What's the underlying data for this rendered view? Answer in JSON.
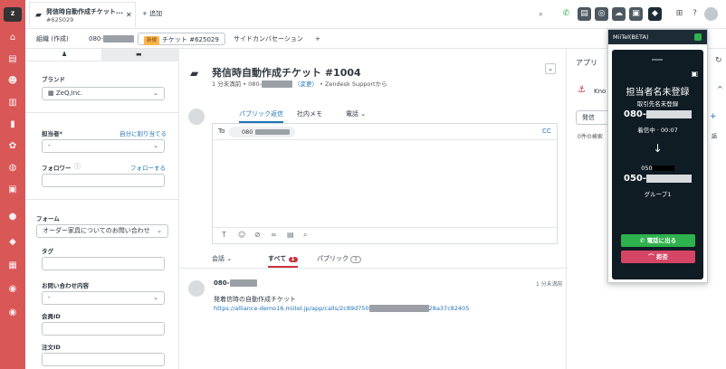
{
  "topbar": {
    "tab_title": "発信時自動作成チケット...",
    "tab_subtitle": "#625029",
    "add_tab": "+ 追加"
  },
  "crumbs": {
    "org": "組織 (作成)",
    "phone_prefix": "080-",
    "new_badge": "新規",
    "ticket": "チケット #625029",
    "side_conv": "サイドカンバセーション",
    "plus": "+"
  },
  "props": {
    "brand_label": "ブランド",
    "brand_value": "ZeQ,Inc.",
    "assignee_label": "担当者*",
    "assign_me": "自分に割り当てる",
    "assignee_value": "-",
    "follower_label": "フォロワー",
    "follow_link": "フォローする",
    "form_label": "フォーム",
    "form_value": "オーダー家具についてのお問い合わせ",
    "tags_label": "タグ",
    "inquiry_label": "お問い合わせ内容",
    "inquiry_value": "-",
    "member_label": "会員ID",
    "order_label": "注文ID"
  },
  "ticket": {
    "title": "発信時自動作成チケット #1004",
    "sub_time": "1 分未満前 • 080-",
    "sub_change": "（変更）",
    "sub_source": "• Zendesk Supportから"
  },
  "composer": {
    "tab_public": "パブリック返信",
    "tab_internal": "社内メモ",
    "tab_phone": "電話",
    "to_label": "To",
    "to_value": "080",
    "cc": "CC"
  },
  "feed": {
    "conv_label": "会話",
    "all_label": "すべて",
    "all_count": "1",
    "public_label": "パブリック",
    "public_count": "1",
    "author": "080-",
    "time": "1 分未満前",
    "line1": "発着信時の自動作成チケット",
    "link_prefix": "https://alliance-demo16.miitel.jp/app/calls/2c89d750",
    "link_suffix": "28a37c82405"
  },
  "apps": {
    "title": "アプリ",
    "kno": "Kno",
    "call_tab": "発信",
    "search_hint": "0件の検索",
    "lang": "語"
  },
  "miitel": {
    "header": "MiiTel(BETA)",
    "name": "担当者名未登録",
    "company": "取引先名未登録",
    "num1": "080-",
    "status": "着信中 · 00:07",
    "arrow": "↓",
    "num2_small": "050",
    "num2": "050-",
    "group": "グループ1",
    "answer": "電話に出る",
    "decline": "拒否"
  },
  "colors": {
    "rail": "#d95757",
    "accent": "#1f73b7",
    "answer": "#2eb24d",
    "decline": "#d64565",
    "popup_bg": "#0f1c24"
  }
}
